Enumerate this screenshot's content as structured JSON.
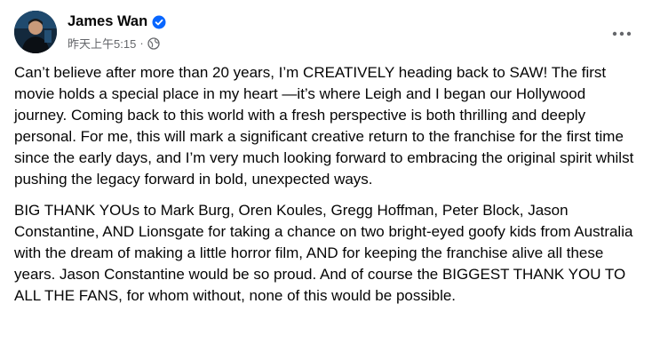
{
  "post": {
    "author": "James Wan",
    "timestamp": "昨天上午5:15",
    "separator": "·",
    "audience_icon": "globe-icon",
    "verified_icon": "verified-badge-icon",
    "more_icon": "more-options-icon",
    "paragraphs": [
      "Can’t believe after more than 20 years, I’m CREATIVELY heading back to SAW! The first movie holds a special place in my heart —it’s where Leigh and I began our Hollywood journey. Coming back to this world with a fresh perspective is both thrilling and deeply personal. For me, this will mark a significant creative return to the franchise for the first time since the early days, and I’m very much looking forward to embracing the original spirit whilst pushing the legacy forward in bold, unexpected ways.",
      "BIG THANK YOUs to Mark Burg, Oren Koules, Gregg Hoffman, Peter Block, Jason Constantine, AND Lionsgate for taking a chance on two bright-eyed goofy kids from Australia with the dream of making a little horror film, AND for keeping the franchise alive all these years. Jason Constantine would be so proud. And of course the BIGGEST THANK YOU TO ALL THE FANS, for whom without, none of this would be possible."
    ]
  },
  "colors": {
    "verified": "#0866ff",
    "secondary_text": "#65676b",
    "primary_text": "#050505"
  }
}
